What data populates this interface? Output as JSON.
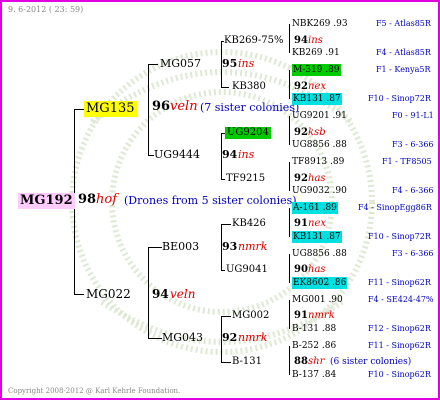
{
  "date_label": "9.  6-2012 ( 23: 59)",
  "copyright": "Copyright 2008-2012 @ Karl Kehrle Foundation.",
  "colors": {
    "frame": "#e000e0",
    "lime": "#00cc00",
    "cyan": "#00e0e0",
    "yellow": "#ffff00",
    "pink": "#ffccff"
  },
  "root": {
    "id": "MG192",
    "num": "98",
    "race": "hof",
    "note": "(Drones from 5 sister colonies)"
  },
  "gen1": {
    "upper": {
      "id": "MG135",
      "num": "96",
      "race": "veln",
      "note": "(7 sister colonies)"
    },
    "lower": {
      "id": "MG022",
      "num": "94",
      "race": "veln"
    }
  },
  "gen2": {
    "a": {
      "id": "MG057",
      "num": "95",
      "race": "ins"
    },
    "b": {
      "id": "UG9444",
      "num": "94",
      "race": "ins"
    },
    "c": {
      "id": "BE003",
      "num": "93",
      "race": "nmrk"
    },
    "d": {
      "id": "MG043",
      "num": "92",
      "race": "nmrk"
    }
  },
  "gen3": {
    "a1": {
      "id": "KB269-75%",
      "num": "94",
      "race": "ins"
    },
    "a2": {
      "id": "KB380",
      "num": "92",
      "race": "nex"
    },
    "b1": {
      "id": "UG9204",
      "num": "92",
      "race": "ksb"
    },
    "b2": {
      "id": "TF9215",
      "num": "92",
      "race": "has"
    },
    "c1": {
      "id": "KB426",
      "num": "91",
      "race": "nex"
    },
    "c2": {
      "id": "UG9041",
      "num": "90",
      "race": "has"
    },
    "d1": {
      "id": "MG002",
      "num": "91",
      "race": "nmrk"
    },
    "d2": {
      "id": "B-131",
      "num": "88",
      "race": "shr",
      "note": "(6 sister colonies)"
    }
  },
  "gen4": [
    {
      "label": "NBK269 .93",
      "src": "F5 - Atlas85R"
    },
    {
      "label": "KB269 .91",
      "src": "F4 - Atlas85R"
    },
    {
      "label": "M-319 .89",
      "src": "F1 - Kenya5R"
    },
    {
      "label": "KB131 .87",
      "src": "F10 - Sinop72R"
    },
    {
      "label": "UG9201 .91",
      "src": "F0 - 91-L1"
    },
    {
      "label": "UG8856 .88",
      "src": "F3 - 6-366"
    },
    {
      "label": "TF8913 .89",
      "src": "F1 - TF8505"
    },
    {
      "label": "UG9032 .90",
      "src": "F4 - 6-366"
    },
    {
      "label": "A-161 .89",
      "src": "F4 - SinopEgg86R"
    },
    {
      "label": "KB131 .87",
      "src": "F10 - Sinop72R"
    },
    {
      "label": "UG8856 .88",
      "src": "F3 - 6-366"
    },
    {
      "label": "EK8602 .86",
      "src": "F11 - Sinop62R"
    },
    {
      "label": "MG001 .90",
      "src": "F4 - SE424-47%"
    },
    {
      "label": "B-131 .88",
      "src": "F12 - Sinop62R"
    },
    {
      "label": "B-252 .86",
      "src": "F11 - Sinop62R"
    },
    {
      "label": "B-137 .84",
      "src": "F10 - Sinop62R"
    }
  ]
}
